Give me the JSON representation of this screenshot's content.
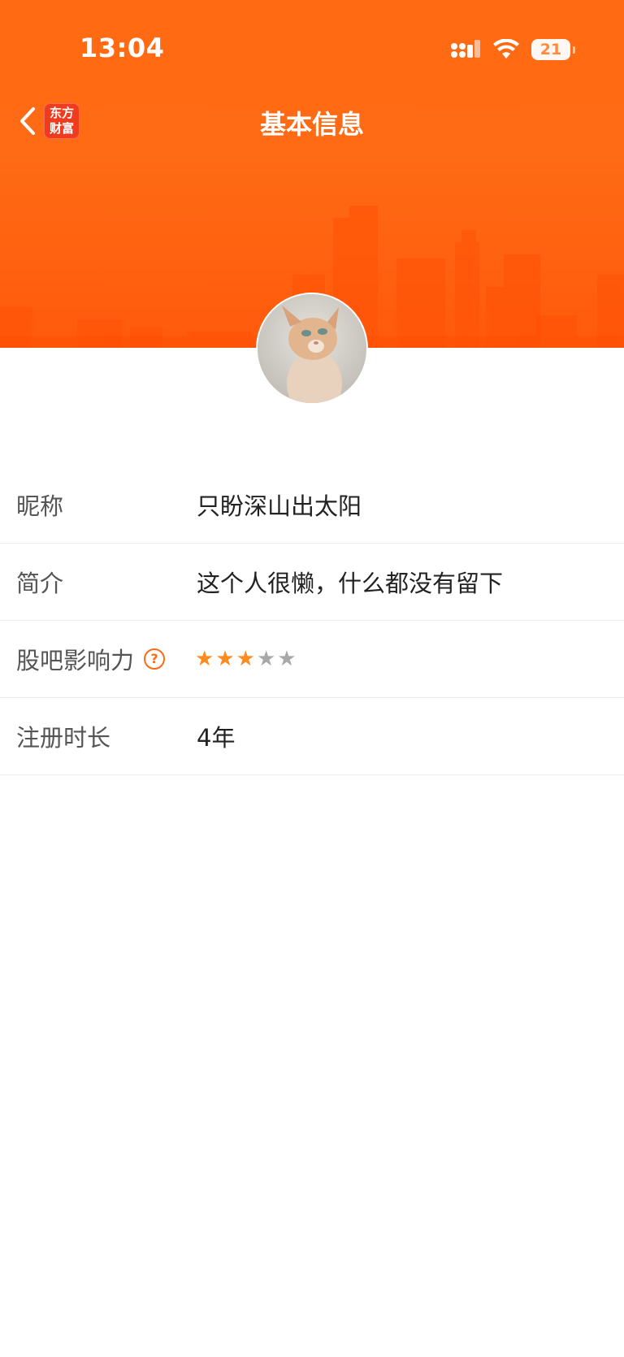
{
  "status_bar": {
    "time": "13:04",
    "battery": "21"
  },
  "nav": {
    "title": "基本信息",
    "brand_line1": "东方",
    "brand_line2": "财富"
  },
  "profile": {
    "rows": [
      {
        "label": "昵称",
        "value": "只盼深山出太阳"
      },
      {
        "label": "简介",
        "value": "这个人很懒，什么都没有留下"
      },
      {
        "label": "股吧影响力",
        "help": "?",
        "stars_filled": 3,
        "stars_total": 5
      },
      {
        "label": "注册时长",
        "value": "4年"
      }
    ]
  },
  "icons": {
    "back": "chevron-left-icon",
    "signal": "cellular-signal-icon",
    "wifi": "wifi-icon",
    "battery": "battery-icon",
    "help": "question-circle-icon",
    "star_filled": "★",
    "star_empty": "★"
  },
  "colors": {
    "brand_orange": "#ff6a14",
    "star_on": "#ff8a1e",
    "star_off": "#a8a8a8",
    "logo_red": "#ef3b1e"
  }
}
